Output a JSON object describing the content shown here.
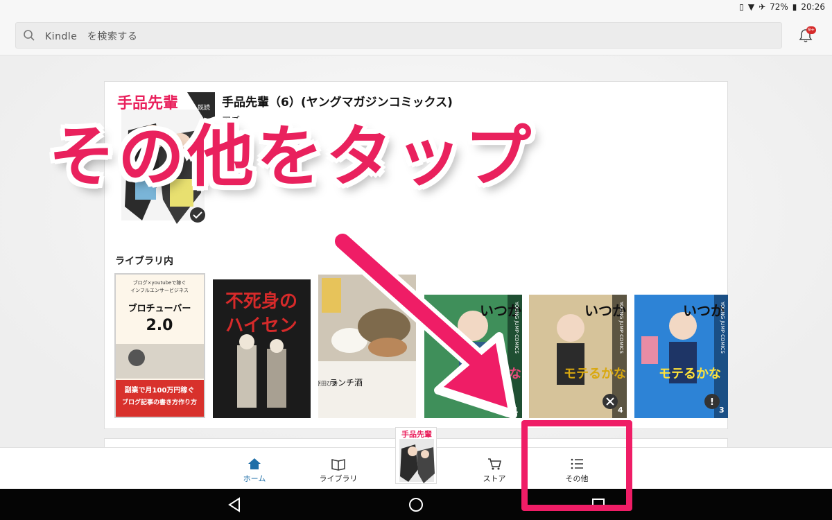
{
  "status_bar": {
    "battery": "72%",
    "time": "20:26"
  },
  "search": {
    "placeholder": "Kindle　を検索する"
  },
  "notifications": {
    "badge": "9+"
  },
  "featured": {
    "title": "手品先輩（6）(ヤングマガジンコミックス)",
    "author": "アズ",
    "cover_text": "手品先輩",
    "cover_badge": "既読"
  },
  "library_section": {
    "label": "ライブラリ内",
    "books": [
      {
        "cover_lines": [
          "ブログ×youtubeで稼ぐ",
          "インフルエンサービジネス",
          "ブロチューバー",
          "2.0",
          "副業で月100万円稼ぐ",
          "ブログ記事の書き方作り方"
        ]
      },
      {
        "cover_lines": [
          "不死身の",
          "ハイセン"
        ]
      },
      {
        "cover_lines": [
          "ランチ酒",
          "原田ひ香"
        ]
      },
      {
        "cover_lines": [
          "いつか",
          "モテるかな",
          "YOUNG JUMP COMICS",
          "1"
        ]
      },
      {
        "cover_lines": [
          "いつか",
          "モテるかな",
          "YOUNG JUMP COMICS",
          "4"
        ]
      },
      {
        "cover_lines": [
          "いつか",
          "モテるかな",
          "YOUNG JUMP COMICS",
          "3"
        ]
      }
    ]
  },
  "bottom_nav": {
    "home": "ホーム",
    "library": "ライブラリ",
    "store": "ストア",
    "more": "その他"
  },
  "annotation": {
    "text": "その他をタップ"
  },
  "colors": {
    "accent": "#e9215d",
    "home_active": "#1f6fa8"
  }
}
